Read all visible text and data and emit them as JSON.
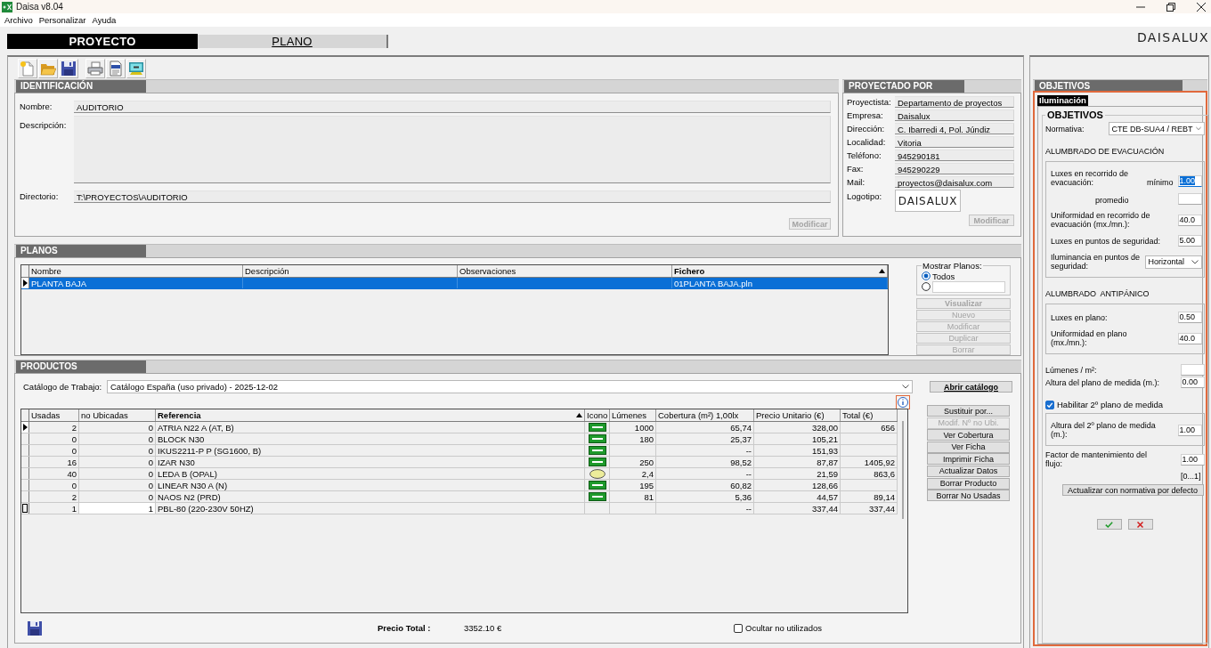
{
  "window": {
    "title": "Daisa v8.04"
  },
  "menu": [
    {
      "label": "Archivo"
    },
    {
      "label": "Personalizar"
    },
    {
      "label": "Ayuda"
    }
  ],
  "main_tabs": [
    {
      "label": "PROYECTO",
      "selected": true
    },
    {
      "label": "PLANO",
      "selected": false
    }
  ],
  "brand_logo": "DAISALUX",
  "identificacion": {
    "title": "IDENTIFICACIÓN",
    "fields": [
      {
        "kind": "line",
        "label": "Nombre:",
        "value": "AUDITORIO"
      },
      {
        "kind": "area",
        "label": "Descripción:"
      },
      {
        "kind": "line",
        "label": "Directorio:",
        "value": "T:\\PROYECTOS\\AUDITORIO"
      }
    ],
    "button": {
      "label": "Modificar",
      "disabled": true,
      "default": true
    }
  },
  "proyectado_por": {
    "title": "PROYECTADO POR",
    "fields": [
      {
        "label": "Proyectista:",
        "value": "Departamento de proyectos"
      },
      {
        "label": "Empresa:",
        "value": "Daisalux"
      },
      {
        "label": "Dirección:",
        "value": "C. Ibarredi 4, Pol. Júndiz"
      },
      {
        "label": "Localidad:",
        "value": "Vitoria"
      },
      {
        "label": "Teléfono:",
        "value": "945290181"
      },
      {
        "label": "Fax:",
        "value": "945290229"
      },
      {
        "label": "Mail:",
        "value": "proyectos@daisalux.com"
      }
    ],
    "logo": {
      "label": "Logotipo:",
      "text": "DAISALUX"
    },
    "button": {
      "label": "Modificar",
      "disabled": true,
      "default": true
    }
  },
  "planos": {
    "title": "PLANOS",
    "columns": [
      {
        "label": "Nombre",
        "sorted": false
      },
      {
        "label": "Descripción",
        "sorted": false
      },
      {
        "label": "Observaciones",
        "sorted": false
      },
      {
        "label": "Fichero",
        "sorted": true
      }
    ],
    "rows": [
      {
        "nombre": "PLANTA BAJA",
        "fichero": "01PLANTA BAJA.pln",
        "selected": true
      }
    ],
    "filter": {
      "title": "Mostrar Planos:",
      "options": [
        {
          "kind": "label",
          "label": "Todos",
          "selected": true
        },
        {
          "kind": "input",
          "selected": false
        }
      ]
    },
    "buttons": [
      {
        "label": "Visualizar",
        "disabled": true,
        "default": true
      },
      {
        "label": "Nuevo",
        "disabled": true,
        "default": false
      },
      {
        "label": "Modificar",
        "disabled": true,
        "default": false
      },
      {
        "label": "Duplicar",
        "disabled": true,
        "default": false
      },
      {
        "label": "Borrar",
        "disabled": true,
        "default": false
      }
    ]
  },
  "productos": {
    "title": "PRODUCTOS",
    "catalog": {
      "label": "Catálogo de Trabajo:",
      "value": "Catálogo España (uso privado) - 2025-12-02"
    },
    "open_catalog": {
      "label": "Abrir catálogo",
      "disabled": false,
      "default": true,
      "focused": true
    },
    "columns": [
      {
        "label": "Usadas",
        "sorted": false
      },
      {
        "label": "no Ubicadas",
        "sorted": false
      },
      {
        "label": "Referencia",
        "sorted": true
      },
      {
        "label": "Icono",
        "sorted": false
      },
      {
        "label": "Lúmenes",
        "sorted": false
      },
      {
        "label": "Cobertura (m²) 1,00lx",
        "sorted": false
      },
      {
        "label": "Precio Unitario (€)",
        "sorted": false
      },
      {
        "label": "Total (€)",
        "sorted": false
      }
    ],
    "rows": [
      {
        "usadas": "2",
        "no_ubicadas": "0",
        "referencia": "ATRIA N22 A (AT, B)",
        "kind": "bar",
        "lumenes": "1000",
        "cobertura": "65,74",
        "precio_unitario": "328,00",
        "total": "656",
        "selected": true,
        "editing": false
      },
      {
        "usadas": "0",
        "no_ubicadas": "0",
        "referencia": "BLOCK N30",
        "kind": "bar",
        "lumenes": "180",
        "cobertura": "25,37",
        "precio_unitario": "105,21",
        "selected": false,
        "editing": false
      },
      {
        "usadas": "0",
        "no_ubicadas": "0",
        "referencia": "IKUS2211-P P (SG1600, B)",
        "kind": "bar",
        "cobertura": "--",
        "precio_unitario": "151,93",
        "selected": false,
        "editing": false
      },
      {
        "usadas": "16",
        "no_ubicadas": "0",
        "referencia": "IZAR N30",
        "kind": "bar",
        "lumenes": "250",
        "cobertura": "98,52",
        "precio_unitario": "87,87",
        "total": "1405,92",
        "selected": false,
        "editing": false
      },
      {
        "usadas": "40",
        "no_ubicadas": "0",
        "referencia": "LEDA B (OPAL)",
        "kind": "oval",
        "lumenes": "2,4",
        "cobertura": "--",
        "precio_unitario": "21,59",
        "total": "863,6",
        "selected": false,
        "editing": false
      },
      {
        "usadas": "0",
        "no_ubicadas": "0",
        "referencia": "LINEAR N30 A (N)",
        "kind": "bar",
        "lumenes": "195",
        "cobertura": "60,82",
        "precio_unitario": "128,66",
        "selected": false,
        "editing": false
      },
      {
        "usadas": "2",
        "no_ubicadas": "0",
        "referencia": "NAOS N2 (PRD)",
        "kind": "bar",
        "lumenes": "81",
        "cobertura": "5,36",
        "precio_unitario": "44,57",
        "total": "89,14",
        "selected": false,
        "editing": false
      },
      {
        "usadas": "1",
        "no_ubicadas": "1",
        "referencia": "PBL-80 (220-230V 50HZ)",
        "kind": "none",
        "cobertura": "--",
        "precio_unitario": "337,44",
        "total": "337,44",
        "selected": false,
        "editing": true
      }
    ],
    "buttons": [
      {
        "label": "Sustituir por...",
        "disabled": false,
        "default": false
      },
      {
        "label": "Modif. Nº no Ubi.",
        "disabled": true,
        "default": false
      },
      {
        "label": "Ver Cobertura",
        "disabled": false,
        "default": false
      },
      {
        "label": "Ver Ficha",
        "disabled": false,
        "default": false
      },
      {
        "label": "Imprimir Ficha",
        "disabled": false,
        "default": false
      },
      {
        "label": "Actualizar Datos",
        "disabled": false,
        "default": false
      },
      {
        "label": "Borrar Producto",
        "disabled": false,
        "default": false
      },
      {
        "label": "Borrar No Usadas",
        "disabled": false,
        "default": false
      }
    ],
    "total": {
      "label": "Precio Total :",
      "value": "3352.10 €"
    },
    "hide_unused": {
      "label": "Ocultar no utilizados",
      "checked": false
    }
  },
  "objetivos": {
    "title": "OBJETIVOS",
    "tabs": [
      {
        "label": "Iluminación",
        "selected": true
      }
    ],
    "group": {
      "title": "OBJETIVOS",
      "items": [
        {
          "kind": "select",
          "label": "Normativa:",
          "value": "CTE DB-SUA4 / REBT"
        },
        {
          "kind": "heading",
          "label": "ALUMBRADO DE EVACUACIÓN"
        },
        {
          "kind": "box",
          "rows": [
            {
              "kind": "input",
              "label": "Luxes en recorrido de evacuación:",
              "sublabel": "mínimo",
              "value": "1.00",
              "focused": true
            },
            {
              "kind": "input",
              "sublabel": "promedio",
              "focused": false
            },
            {
              "kind": "input",
              "label": "Uniformidad en recorrido de evacuación (mx./mn.):",
              "value": "40.0",
              "focused": false
            },
            {
              "kind": "input",
              "label": "Luxes en puntos de seguridad:",
              "value": "5.00",
              "focused": false
            },
            {
              "kind": "select",
              "label": "Iluminancia en puntos de seguridad:",
              "value": "Horizontal"
            }
          ]
        },
        {
          "kind": "heading",
          "label": "ALUMBRADO  ANTIPÁNICO"
        },
        {
          "kind": "box",
          "rows": [
            {
              "kind": "input",
              "label": "Luxes en plano:",
              "value": "0.50",
              "focused": false
            },
            {
              "kind": "input",
              "label": "Uniformidad en plano (mx./mn.):",
              "value": "40.0",
              "focused": false
            }
          ]
        },
        {
          "kind": "input",
          "label": "Lúmenes / m²:",
          "focused": false
        },
        {
          "kind": "input",
          "label": "Altura del plano de medida (m.):",
          "value": "0.00",
          "focused": false
        },
        {
          "kind": "checkbox",
          "label": "Habilitar 2º plano de medida",
          "checked": true
        },
        {
          "kind": "box",
          "rows": [
            {
              "kind": "input",
              "label": "Altura del 2º plano de medida (m.):",
              "value": "1.00",
              "focused": false
            }
          ]
        },
        {
          "kind": "input",
          "label": "Factor de mantenimiento del flujo:",
          "value": "1.00",
          "focused": false
        },
        {
          "kind": "hint",
          "label": "[0...1]"
        },
        {
          "kind": "button",
          "label": "Actualizar con normativa por defecto"
        }
      ]
    }
  }
}
